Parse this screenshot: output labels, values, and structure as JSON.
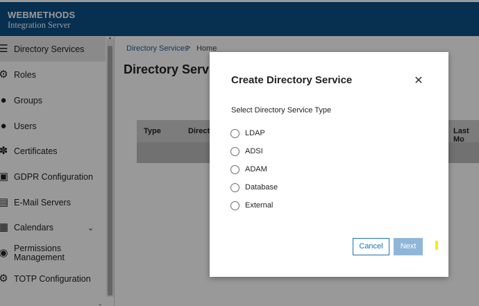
{
  "header": {
    "brand_title": "WEBMETHODS",
    "brand_subtitle": "Integration Server",
    "bar_color": "#0a4f86"
  },
  "sidebar": {
    "items": [
      {
        "label": "Directory Services",
        "icon": "directory-icon",
        "active": true
      },
      {
        "label": "Roles",
        "icon": "roles-icon"
      },
      {
        "label": "Groups",
        "icon": "groups-icon"
      },
      {
        "label": "Users",
        "icon": "users-icon"
      },
      {
        "label": "Certificates",
        "icon": "certificate-icon"
      },
      {
        "label": "GDPR Configuration",
        "icon": "gdpr-icon"
      },
      {
        "label": "E-Mail Servers",
        "icon": "email-server-icon"
      },
      {
        "label": "Calendars",
        "icon": "calendar-icon",
        "expandable": true
      },
      {
        "label": "Permissions Management",
        "icon": "permissions-icon"
      },
      {
        "label": "TOTP Configuration",
        "icon": "totp-icon"
      }
    ]
  },
  "breadcrumb": {
    "parent": "Directory Services",
    "separator": ">",
    "current": "Home"
  },
  "main": {
    "page_title": "Directory Servic",
    "table": {
      "columns": [
        "Type",
        "Directo",
        "Last Mo"
      ]
    }
  },
  "modal": {
    "title": "Create Directory Service",
    "section_label": "Select Directory Service Type",
    "options": [
      "LDAP",
      "ADSI",
      "ADAM",
      "Database",
      "External"
    ],
    "cancel_label": "Cancel",
    "next_label": "Next",
    "next_enabled": false,
    "accent_color": "#1f6fb0"
  }
}
